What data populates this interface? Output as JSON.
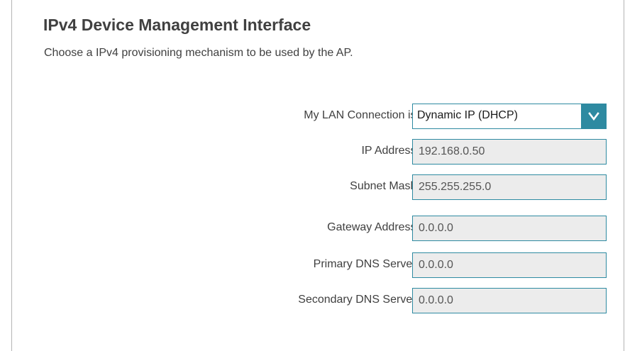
{
  "header": {
    "title": "IPv4 Device Management Interface",
    "subtitle": "Choose a IPv4 provisioning mechanism to be used by the AP."
  },
  "form": {
    "connection": {
      "label": "My LAN Connection is:",
      "value": "Dynamic IP (DHCP)",
      "icon": "chevron-down-icon"
    },
    "ip_address": {
      "label": "IP Address:",
      "value": "192.168.0.50"
    },
    "subnet_mask": {
      "label": "Subnet Mask:",
      "value": "255.255.255.0"
    },
    "gateway": {
      "label": "Gateway Address:",
      "value": "0.0.0.0"
    },
    "primary_dns": {
      "label": "Primary DNS Server:",
      "value": "0.0.0.0"
    },
    "secondary_dns": {
      "label": "Secondary DNS Server:",
      "value": "0.0.0.0"
    }
  },
  "colors": {
    "accent": "#2e8aa1",
    "text": "#404040",
    "field_background": "#ececec"
  }
}
